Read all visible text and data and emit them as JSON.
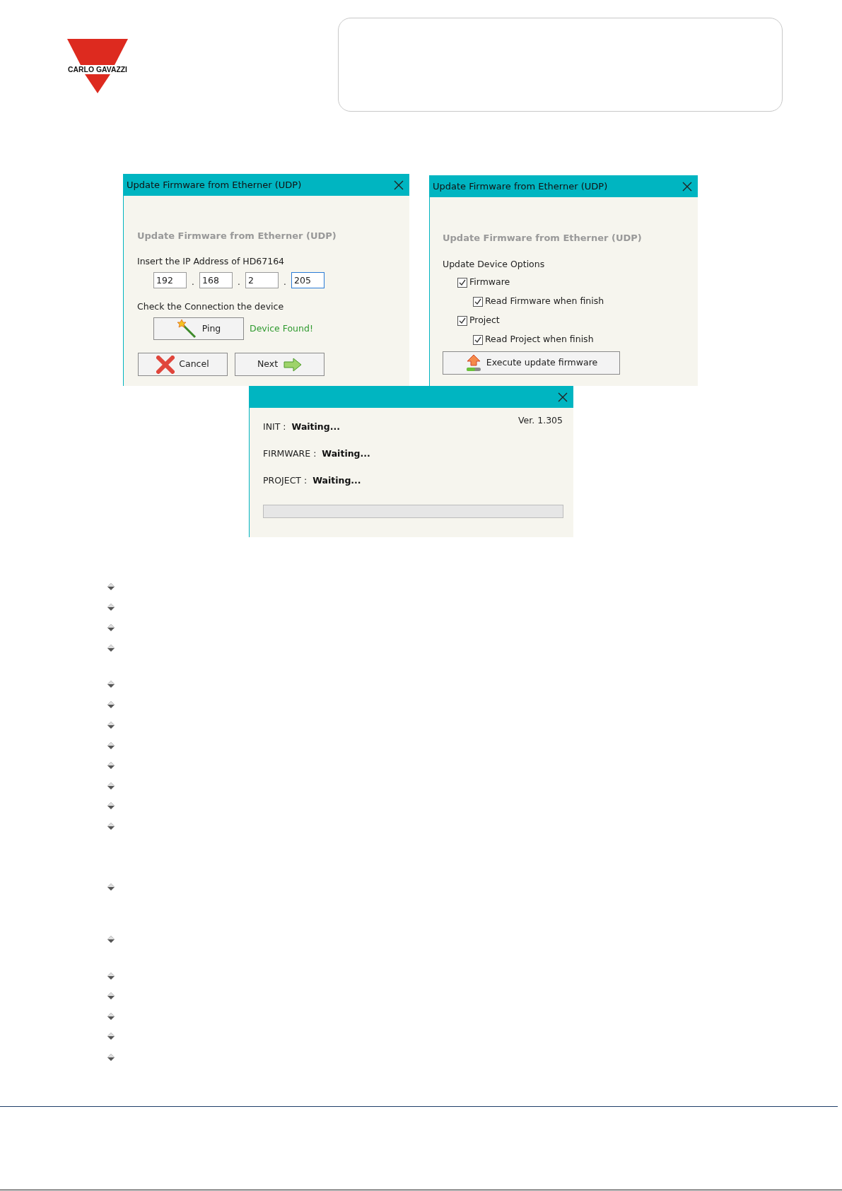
{
  "logo": {
    "text": "CARLO GAVAZZI"
  },
  "ip_dialog": {
    "title": "Update Firmware from Etherner (UDP)",
    "heading": "Update Firmware from Etherner (UDP)",
    "ip_label": "Insert the IP Address of HD67164",
    "ip_fields": [
      {
        "value": "192",
        "focused": false
      },
      {
        "value": "168",
        "focused": false
      },
      {
        "value": "2",
        "focused": false
      },
      {
        "value": "205",
        "focused": true
      }
    ],
    "separator": ".",
    "check_label": "Check the Connection the device",
    "ping_button": "Ping",
    "status": "Device Found!",
    "cancel_button": "Cancel",
    "next_button": "Next"
  },
  "options_dialog": {
    "title": "Update Firmware from Etherner (UDP)",
    "heading": "Update Firmware from Etherner (UDP)",
    "options_label": "Update Device Options",
    "options": [
      {
        "label": "Firmware",
        "checked": true,
        "children": [
          {
            "label": "Read Firmware when finish",
            "checked": true
          }
        ]
      },
      {
        "label": "Project",
        "checked": true,
        "children": [
          {
            "label": "Read Project when finish",
            "checked": true
          }
        ]
      }
    ],
    "execute_button": "Execute update firmware"
  },
  "progress_dialog": {
    "version": "Ver. 1.305",
    "steps": [
      {
        "name": "INIT :",
        "status": "Waiting..."
      },
      {
        "name": "FIRMWARE :",
        "status": "Waiting..."
      },
      {
        "name": "PROJECT :",
        "status": "Waiting..."
      }
    ],
    "progress": {
      "level": 0
    }
  }
}
